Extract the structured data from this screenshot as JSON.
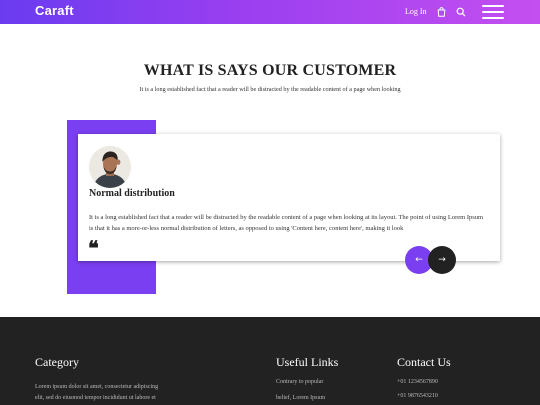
{
  "header": {
    "logo": "Caraft",
    "login_label": "Log In"
  },
  "customers": {
    "title": "WHAT IS SAYS OUR CUSTOMER",
    "subtitle": "It is a long established fact that a reader will be distracted by the readable content of a page when looking"
  },
  "testimonial": {
    "name": "Normal distribution",
    "text": "It is a long established fact that a reader will be distracted by the readable content of a page when looking at its layout. The point of using Lorem Ipsum is that it has a more-or-less normal distribution of letters, as opposed to using 'Content here, content here', making it look",
    "quote_glyph": "❝",
    "prev_arrow": "←",
    "next_arrow": "→"
  },
  "footer": {
    "category": {
      "heading": "Category",
      "lines": [
        "Lorem ipsum dolor sit amet, consectetur adipiscing",
        "elit, sed do eiusmod tempor incididunt ut labore et"
      ]
    },
    "useful_links": {
      "heading": "Useful Links",
      "items": [
        "Contrary to popular",
        "belief, Lorem Ipsum"
      ]
    },
    "contact": {
      "heading": "Contact Us",
      "items": [
        "+01 1234567890",
        "+01 9876543210"
      ]
    }
  },
  "colors": {
    "brand_purple": "#7b3ff2",
    "dark": "#222222"
  },
  "icons": [
    "cart-icon",
    "search-icon",
    "menu-icon",
    "quote-icon",
    "arrow-left-icon",
    "arrow-right-icon"
  ]
}
